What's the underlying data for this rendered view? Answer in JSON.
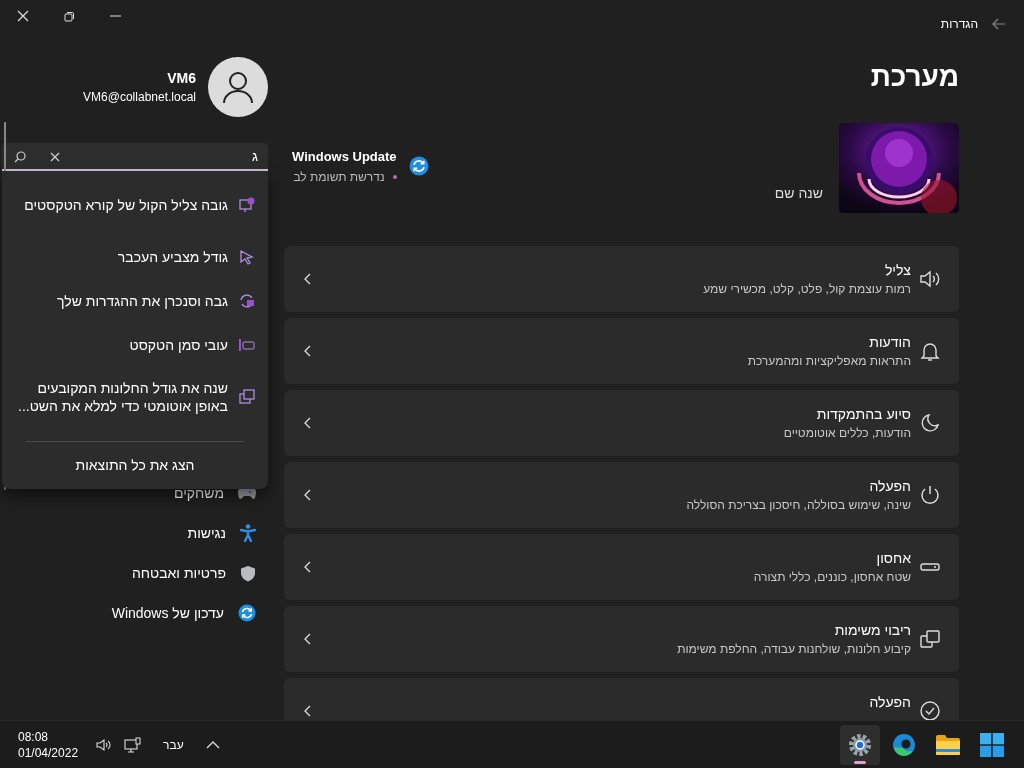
{
  "window": {
    "title": "הגדרות"
  },
  "account": {
    "name": "VM6",
    "email": "VM6@collabnet.local"
  },
  "search": {
    "value": "ג"
  },
  "search_results": [
    {
      "label": "גובה צליל הקול של קורא הטקסטים",
      "kind": "narrator"
    },
    {
      "label": "גודל מצביע העכבר",
      "kind": "pointer"
    },
    {
      "label": "גבה וסנכרן את ההגדרות שלך",
      "kind": "sync"
    },
    {
      "label": "עובי סמן הטקסט",
      "kind": "text-cursor"
    },
    {
      "label": "שנה את גודל החלונות המקובעים באופן אוטומטי כדי למלא את השט...",
      "kind": "snap"
    }
  ],
  "show_all": "הצג את כל התוצאות",
  "nav_items": [
    {
      "label": "משחקים",
      "kind": "gaming"
    },
    {
      "label": "נגישות",
      "kind": "accessibility"
    },
    {
      "label": "פרטיות ואבטחה",
      "kind": "privacy"
    },
    {
      "label": "עדכון של Windows",
      "kind": "update"
    }
  ],
  "page": {
    "title": "מערכת",
    "rename": "שנה שם",
    "update": {
      "title": "Windows Update",
      "status": "נדרשת תשומת לב"
    }
  },
  "settings_rows": [
    {
      "title": "צליל",
      "subtitle": "רמות עוצמת קול, פלט, קלט, מכשירי שמע",
      "kind": "sound"
    },
    {
      "title": "הודעות",
      "subtitle": "התראות מאפליקציות ומהמערכת",
      "kind": "notifications"
    },
    {
      "title": "סיוע בהתמקדות",
      "subtitle": "הודעות, כללים אוטומטיים",
      "kind": "focus"
    },
    {
      "title": "הפעלה",
      "subtitle": "שינה, שימוש בסוללה, חיסכון בצריכת הסוללה",
      "kind": "power"
    },
    {
      "title": "אחסון",
      "subtitle": "שטח אחסון, כוננים, כללי תצורה",
      "kind": "storage"
    },
    {
      "title": "ריבוי משימות",
      "subtitle": "קיבוע חלונות, שולחנות עבודה, החלפת משימות",
      "kind": "multitasking"
    },
    {
      "title": "הפעלה",
      "kind": "activation"
    }
  ],
  "taskbar": {
    "apps": [
      {
        "kind": "start",
        "selected": false
      },
      {
        "kind": "explorer",
        "selected": false
      },
      {
        "kind": "edge",
        "selected": false
      },
      {
        "kind": "settings",
        "selected": true
      }
    ],
    "language": "עבר",
    "time": "08:08",
    "date": "01/04/2022"
  }
}
